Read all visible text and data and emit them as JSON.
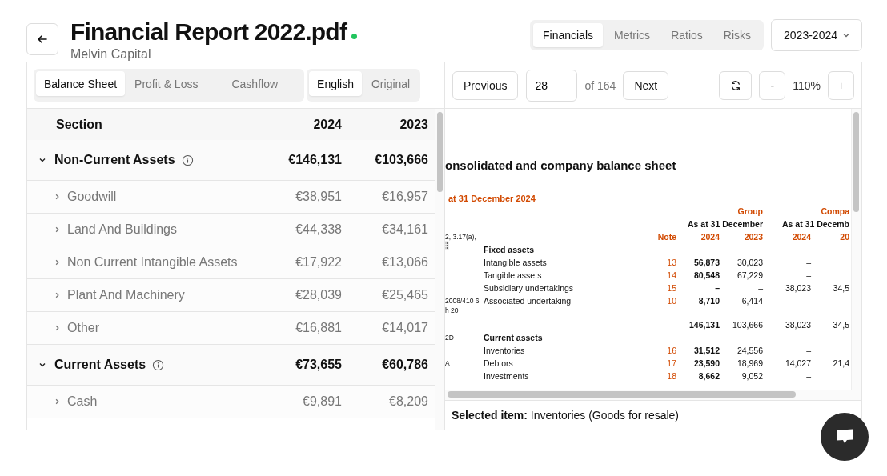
{
  "header": {
    "title": "Financial Report 2022.pdf",
    "status": {
      "color": "#22c55e"
    },
    "subtitle": "Melvin Capital"
  },
  "view_tabs": [
    {
      "label": "Financials",
      "selected": true
    },
    {
      "label": "Metrics",
      "selected": false
    },
    {
      "label": "Ratios",
      "selected": false
    },
    {
      "label": "Risks",
      "selected": false
    }
  ],
  "year_select": {
    "value": "2023-2024"
  },
  "statement_tabs": [
    {
      "label": "Balance Sheet",
      "selected": true
    },
    {
      "label": "Profit & Loss",
      "selected": false
    },
    {
      "label": "Cashflow",
      "selected": false
    }
  ],
  "language_tabs": [
    {
      "label": "English",
      "selected": true
    },
    {
      "label": "Original",
      "selected": false
    }
  ],
  "table": {
    "columns": [
      "Section",
      "2024",
      "2023"
    ],
    "groups": [
      {
        "label": "Non-Current Assets",
        "expanded": true,
        "values": [
          "€146,131",
          "€103,666"
        ],
        "children": [
          {
            "label": "Goodwill",
            "expanded": false,
            "values": [
              "€38,951",
              "€16,957"
            ]
          },
          {
            "label": "Land And Buildings",
            "expanded": false,
            "values": [
              "€44,338",
              "€34,161"
            ]
          },
          {
            "label": "Non Current Intangible Assets",
            "expanded": false,
            "values": [
              "€17,922",
              "€13,066"
            ]
          },
          {
            "label": "Plant And Machinery",
            "expanded": false,
            "values": [
              "€28,039",
              "€25,465"
            ]
          },
          {
            "label": "Other",
            "expanded": false,
            "values": [
              "€16,881",
              "€14,017"
            ]
          }
        ]
      },
      {
        "label": "Current Assets",
        "expanded": true,
        "values": [
          "€73,655",
          "€60,786"
        ],
        "children": [
          {
            "label": "Cash",
            "expanded": false,
            "values": [
              "€9,891",
              "€8,209"
            ]
          }
        ]
      }
    ]
  },
  "pager": {
    "previous": "Previous",
    "page": "28",
    "total": "of 164",
    "next": "Next",
    "zoom_out": "-",
    "zoom": "110%",
    "zoom_in": "+"
  },
  "document": {
    "title": "onsolidated and company balance sheet",
    "subtitle": "at 31 December 2024",
    "group_label": "Group",
    "company_label": "Compa",
    "as_at": [
      "As at 31 December",
      "As at 31 Decemb"
    ],
    "margin_note": "2, 3.17(a),",
    "note_header": "Note",
    "years": [
      "2024",
      "2023",
      "2024",
      "20"
    ],
    "rows": [
      {
        "kind": "heading",
        "label": "Fixed assets"
      },
      {
        "kind": "item",
        "label": "Intangible assets",
        "note": "13",
        "values": [
          "56,873",
          "30,023",
          "–"
        ]
      },
      {
        "kind": "item",
        "label": "Tangible assets",
        "note": "14",
        "values": [
          "80,548",
          "67,229",
          "–"
        ]
      },
      {
        "kind": "item",
        "label": "Subsidiary undertakings",
        "note": "15",
        "values": [
          "–",
          "–",
          "38,023",
          "34,5"
        ]
      },
      {
        "kind": "item",
        "margin": "2008/410 6",
        "label": "Associated undertaking",
        "note": "10",
        "values": [
          "8,710",
          "6,414",
          "–"
        ]
      },
      {
        "kind": "margin",
        "margin": "h 20"
      },
      {
        "kind": "total",
        "values": [
          "146,131",
          "103,666",
          "38,023",
          "34,5"
        ]
      },
      {
        "kind": "heading",
        "margin": "2D",
        "label": "Current assets"
      },
      {
        "kind": "item",
        "label": "Inventories",
        "note": "16",
        "values": [
          "31,512",
          "24,556",
          "–"
        ]
      },
      {
        "kind": "item",
        "margin": "A",
        "label": "Debtors",
        "note": "17",
        "values": [
          "23,590",
          "18,969",
          "14,027",
          "21,4"
        ]
      },
      {
        "kind": "item",
        "label": "Investments",
        "note": "18",
        "values": [
          "8,662",
          "9,052",
          "–"
        ]
      }
    ]
  },
  "selection": {
    "text": "**Selected item:** Inventories (Goods for resale)"
  }
}
